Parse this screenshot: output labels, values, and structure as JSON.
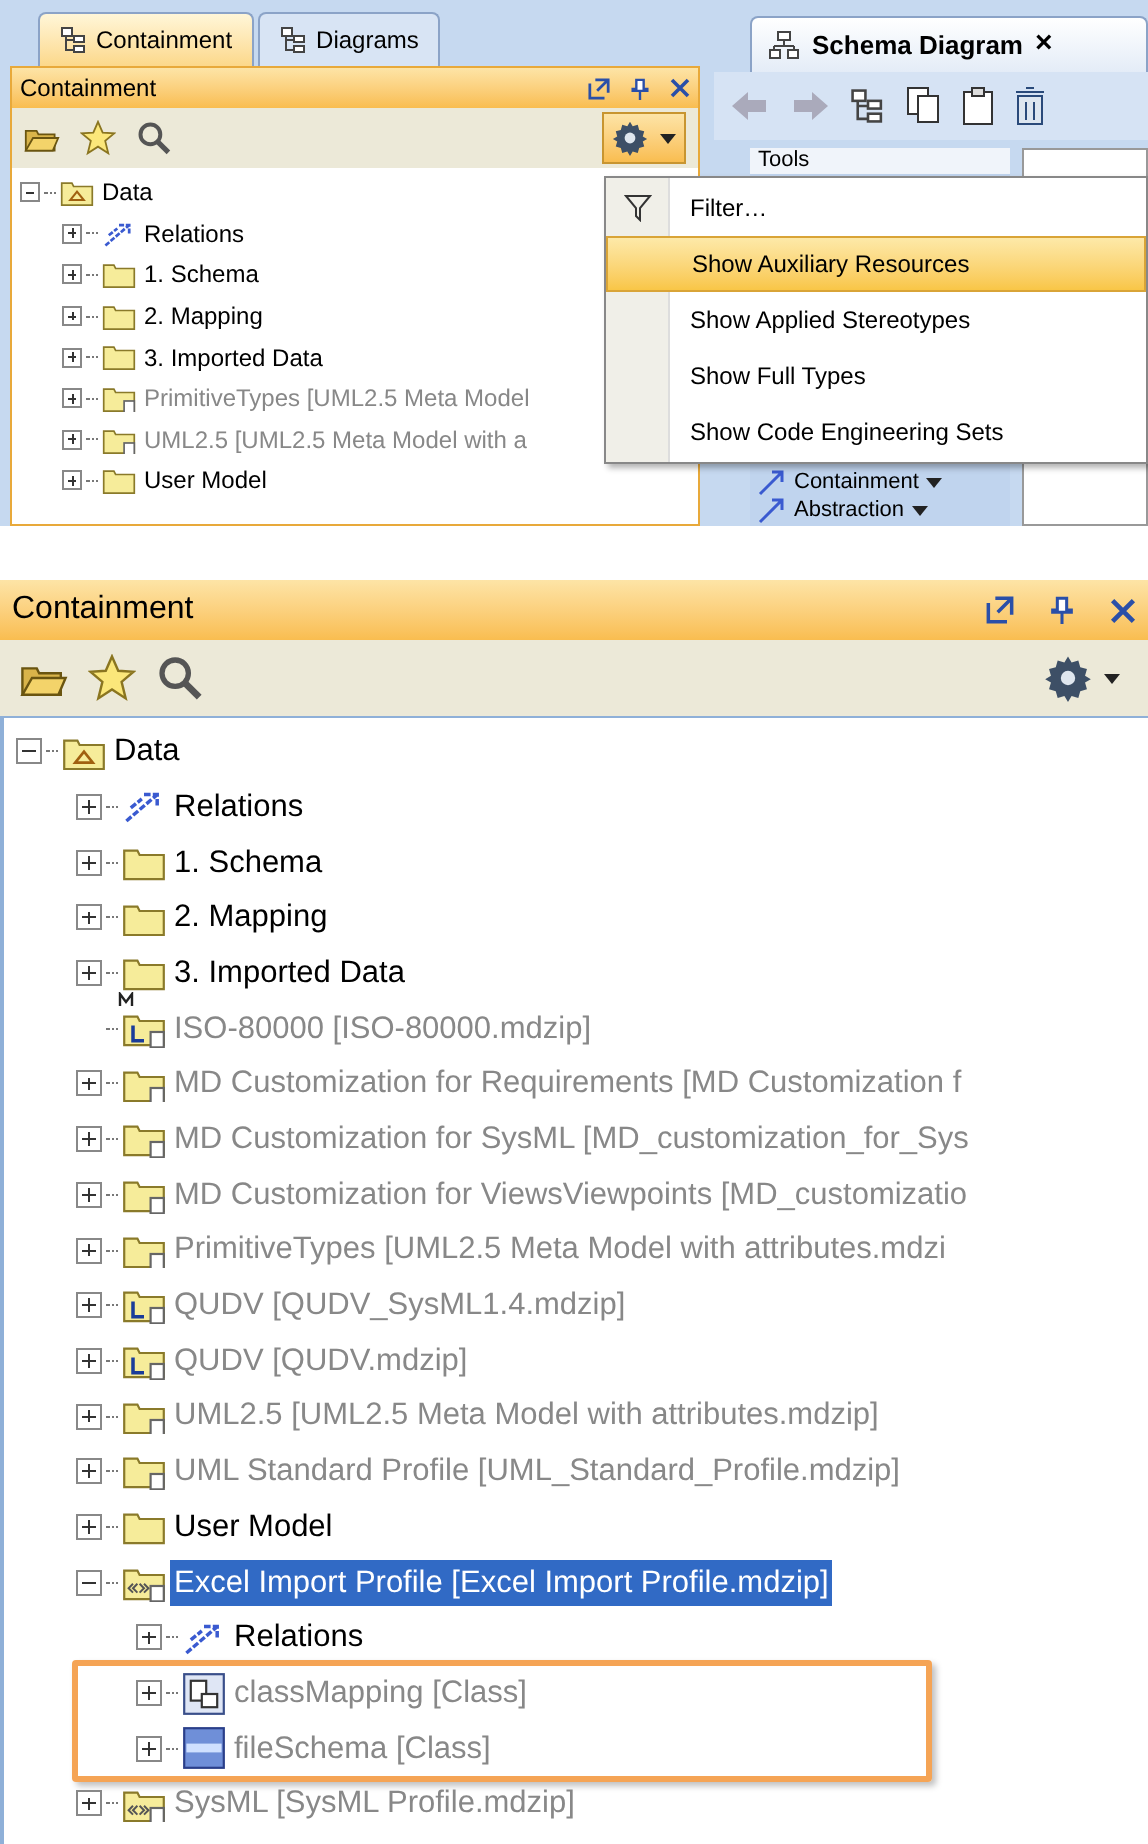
{
  "top_view": {
    "tabs": [
      {
        "label": "Containment",
        "selected": true
      },
      {
        "label": "Diagrams",
        "selected": false
      }
    ],
    "panel": {
      "title": "Containment",
      "tree": [
        {
          "label": "Data",
          "kind": "data",
          "expanded": true,
          "muted": false,
          "selected": false,
          "children": [
            {
              "label": "Relations",
              "kind": "relations",
              "expanded": false,
              "muted": false,
              "selected": false
            },
            {
              "label": "1. Schema",
              "kind": "folder",
              "expanded": false,
              "muted": false,
              "selected": false
            },
            {
              "label": "2. Mapping",
              "kind": "folder",
              "expanded": false,
              "muted": false,
              "selected": false
            },
            {
              "label": "3. Imported Data",
              "kind": "folder",
              "expanded": false,
              "muted": false,
              "selected": false
            },
            {
              "label": "PrimitiveTypes [UML2.5 Meta Model",
              "kind": "shared",
              "expanded": false,
              "muted": true,
              "selected": false
            },
            {
              "label": "UML2.5 [UML2.5 Meta Model with a",
              "kind": "shared",
              "expanded": false,
              "muted": true,
              "selected": false
            },
            {
              "label": "User Model",
              "kind": "folder",
              "expanded": false,
              "muted": false,
              "selected": false
            }
          ]
        }
      ]
    },
    "menu": [
      {
        "label": "Filter…",
        "kind": "filter",
        "selected": false
      },
      {
        "label": "Show Auxiliary Resources",
        "kind": "plain",
        "selected": true
      },
      {
        "label": "Show Applied Stereotypes",
        "kind": "plain",
        "selected": false
      },
      {
        "label": "Show Full Types",
        "kind": "plain",
        "selected": false
      },
      {
        "label": "Show Code Engineering Sets",
        "kind": "plain",
        "selected": false
      }
    ],
    "diagram": {
      "tab": "Schema Diagram",
      "close": "×",
      "palette_header": "Tools",
      "palette_items": [
        "Containment",
        "Abstraction"
      ]
    }
  },
  "bottom_view": {
    "title": "Containment",
    "tree": [
      {
        "label": "Data",
        "kind": "data",
        "expanded": true,
        "muted": false,
        "selected": false,
        "children": [
          {
            "label": "Relations",
            "kind": "relations",
            "expanded": false,
            "muted": false,
            "selected": false
          },
          {
            "label": "1. Schema",
            "kind": "folder",
            "expanded": false,
            "muted": false,
            "selected": false
          },
          {
            "label": "2. Mapping",
            "kind": "folder",
            "expanded": false,
            "muted": false,
            "selected": false
          },
          {
            "label": "3. Imported Data",
            "kind": "folder",
            "expanded": false,
            "muted": false,
            "selected": false
          },
          {
            "label": "ISO-80000 [ISO-80000.mdzip]",
            "kind": "library_leaf",
            "muted": true,
            "selected": false
          },
          {
            "label": "MD Customization for Requirements [MD Customization f",
            "kind": "shared",
            "expanded": false,
            "muted": true,
            "selected": false
          },
          {
            "label": "MD Customization for SysML [MD_customization_for_Sys",
            "kind": "shared",
            "expanded": false,
            "muted": true,
            "selected": false
          },
          {
            "label": "MD Customization for ViewsViewpoints [MD_customizatio",
            "kind": "shared",
            "expanded": false,
            "muted": true,
            "selected": false
          },
          {
            "label": "PrimitiveTypes [UML2.5 Meta Model with attributes.mdzi",
            "kind": "shared",
            "expanded": false,
            "muted": true,
            "selected": false
          },
          {
            "label": "QUDV [QUDV_SysML1.4.mdzip]",
            "kind": "library",
            "expanded": false,
            "muted": true,
            "selected": false
          },
          {
            "label": "QUDV [QUDV.mdzip]",
            "kind": "library",
            "expanded": false,
            "muted": true,
            "selected": false
          },
          {
            "label": "UML2.5 [UML2.5 Meta Model with attributes.mdzip]",
            "kind": "shared",
            "expanded": false,
            "muted": true,
            "selected": false
          },
          {
            "label": "UML Standard Profile [UML_Standard_Profile.mdzip]",
            "kind": "shared",
            "expanded": false,
            "muted": true,
            "selected": false
          },
          {
            "label": "User Model",
            "kind": "folder",
            "expanded": false,
            "muted": false,
            "selected": false
          },
          {
            "label": "Excel Import Profile [Excel Import Profile.mdzip]",
            "kind": "profile",
            "expanded": true,
            "muted": false,
            "selected": true,
            "children": [
              {
                "label": "Relations",
                "kind": "relations",
                "expanded": false,
                "muted": false,
                "selected": false,
                "highlighted": false
              },
              {
                "label": "classMapping [Class]",
                "kind": "mapping",
                "expanded": false,
                "muted": true,
                "selected": false,
                "highlighted": true
              },
              {
                "label": "fileSchema [Class]",
                "kind": "schema",
                "expanded": false,
                "muted": true,
                "selected": false,
                "highlighted": true
              }
            ]
          },
          {
            "label": "SysML [SysML Profile.mdzip]",
            "kind": "profile",
            "expanded": false,
            "muted": true,
            "selected": false
          }
        ]
      }
    ]
  }
}
